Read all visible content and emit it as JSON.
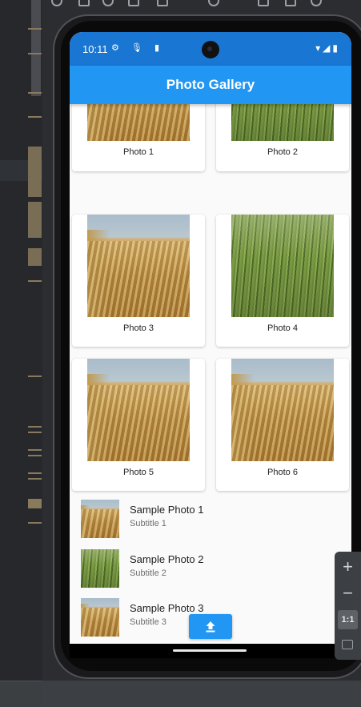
{
  "status_bar": {
    "time": "10:11",
    "left_icons": "⚙ 🎙 ▮",
    "right_icons": "▾◢▮"
  },
  "app_bar": {
    "title": "Photo Gallery"
  },
  "grid": [
    {
      "caption": "Photo 1",
      "kind": "wheat"
    },
    {
      "caption": "Photo 2",
      "kind": "grass"
    },
    {
      "caption": "Photo 3",
      "kind": "wheat"
    },
    {
      "caption": "Photo 4",
      "kind": "grass"
    },
    {
      "caption": "Photo 5",
      "kind": "wheat"
    },
    {
      "caption": "Photo 6",
      "kind": "wheat"
    }
  ],
  "list": [
    {
      "title": "Sample Photo 1",
      "subtitle": "Subtitle 1",
      "kind": "wheat"
    },
    {
      "title": "Sample Photo 2",
      "subtitle": "Subtitle 2",
      "kind": "grass"
    },
    {
      "title": "Sample Photo 3",
      "subtitle": "Subtitle 3",
      "kind": "wheat"
    }
  ],
  "upload_button": {
    "icon": "upload-icon"
  },
  "ide": {
    "zoom_in": "+",
    "zoom_out": "−",
    "zoom_actual": "1:1",
    "zoom_fit_icon": "fit-screen-icon"
  },
  "colors": {
    "status_bar": "#1976d2",
    "app_bar": "#2196f3",
    "button": "#2196f3"
  }
}
